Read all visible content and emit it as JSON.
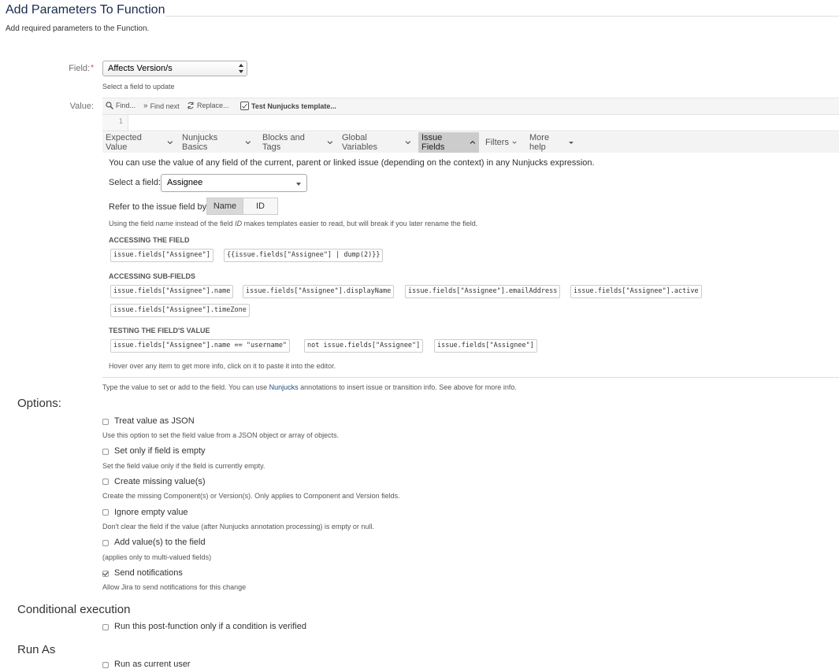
{
  "header": {
    "title": "Add Parameters To Function",
    "description": "Add required parameters to the Function."
  },
  "field": {
    "label": "Field:",
    "required_mark": "*",
    "selected": "Affects Version/s",
    "hint": "Select a field to update"
  },
  "value": {
    "label": "Value:",
    "toolbar": {
      "find": "Find...",
      "find_next": "Find next",
      "replace": "Replace...",
      "test": "Test Nunjucks template..."
    },
    "line_number": "1",
    "hint_before": "Type the value to set or add to the field. You can use ",
    "hint_link": "Nunjucks",
    "hint_after": " annotations to insert issue or transition info. See above for more info."
  },
  "help_tabs": [
    {
      "label": "Expected Value"
    },
    {
      "label": "Nunjucks Basics"
    },
    {
      "label": "Blocks and Tags"
    },
    {
      "label": "Global Variables"
    },
    {
      "label": "Issue Fields",
      "active": true
    },
    {
      "label": "Filters"
    },
    {
      "label": "More help"
    }
  ],
  "issue_fields": {
    "intro": "You can use the value of any field of the current, parent or linked issue (depending on the context) in any Nunjucks expression.",
    "select_label": "Select a field:",
    "selected_field": "Assignee",
    "refer_label": "Refer to the issue field by:",
    "refer_name": "Name",
    "refer_id": "ID",
    "note_1": "Using the field ",
    "note_name": "name",
    "note_2": " instead of the field ",
    "note_id": "ID",
    "note_3": " makes templates easier to read, but will break if you later rename the field.",
    "accessing_heading": "ACCESSING THE FIELD",
    "accessing": [
      "issue.fields[\"Assignee\"]",
      "{{issue.fields[\"Assignee\"] | dump(2)}}"
    ],
    "sub_heading": "ACCESSING SUB-FIELDS",
    "sub": [
      "issue.fields[\"Assignee\"].name",
      "issue.fields[\"Assignee\"].displayName",
      "issue.fields[\"Assignee\"].emailAddress",
      "issue.fields[\"Assignee\"].active",
      "issue.fields[\"Assignee\"].timeZone"
    ],
    "testing_heading": "TESTING THE FIELD'S VALUE",
    "testing": [
      "issue.fields[\"Assignee\"].name == \"username\"",
      "not issue.fields[\"Assignee\"]",
      "issue.fields[\"Assignee\"]"
    ],
    "footer": "Hover over any item to get more info, click on it to paste it into the editor."
  },
  "options": {
    "heading": "Options:",
    "items": [
      {
        "label": "Treat value as JSON",
        "hint": "Use this option to set the field value from a JSON object or array of objects.",
        "checked": false
      },
      {
        "label": "Set only if field is empty",
        "hint": "Set the field value only if the field is currently empty.",
        "checked": false
      },
      {
        "label": "Create missing value(s)",
        "hint": "Create the missing Component(s) or Version(s). Only applies to Component and Version fields.",
        "checked": false
      },
      {
        "label": "Ignore empty value",
        "hint": "Don't clear the field if the value (after Nunjucks annotation processing) is empty or null.",
        "checked": false
      },
      {
        "label": "Add value(s) to the field",
        "hint": "(applies only to multi-valued fields)",
        "checked": false
      },
      {
        "label": "Send notifications",
        "hint": "Allow Jira to send notifications for this change",
        "checked": true
      }
    ]
  },
  "conditional": {
    "heading": "Conditional execution",
    "label": "Run this post-function only if a condition is verified"
  },
  "run_as": {
    "heading": "Run As",
    "label": "Run as current user"
  }
}
